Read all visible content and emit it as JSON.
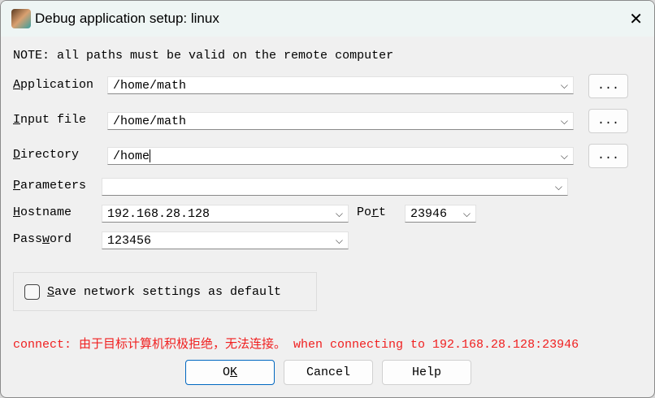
{
  "window": {
    "title": "Debug application setup: linux",
    "close_icon": "close-icon"
  },
  "note": "NOTE: all paths must be valid on the remote computer",
  "fields": {
    "application": {
      "label_u": "A",
      "label_rest": "pplication",
      "value": "/home/math",
      "browse": "..."
    },
    "input_file": {
      "label_u": "I",
      "label_rest": "nput file",
      "value": "/home/math",
      "browse": "..."
    },
    "directory": {
      "label_u": "D",
      "label_rest": "irectory",
      "value": "/home",
      "browse": "..."
    },
    "parameters": {
      "label_u": "P",
      "label_rest": "arameters",
      "value": ""
    },
    "hostname": {
      "label_u": "H",
      "label_rest": "ostname",
      "value": "192.168.28.128"
    },
    "port": {
      "label_pre": "Po",
      "label_u": "r",
      "label_rest": "t",
      "value": "23946"
    },
    "password": {
      "label_pre": "Pass",
      "label_u": "w",
      "label_rest": "ord",
      "value": "123456"
    }
  },
  "save_default": {
    "label_u": "S",
    "label_rest": "ave network settings as default",
    "checked": false
  },
  "error": "connect: 由于目标计算机积极拒绝，无法连接。 when connecting to 192.168.28.128:23946",
  "buttons": {
    "ok_pre": "O",
    "ok_u": "K",
    "cancel": "Cancel",
    "help": "Help"
  },
  "colors": {
    "error": "#f02020",
    "ok_border": "#0067c0"
  }
}
